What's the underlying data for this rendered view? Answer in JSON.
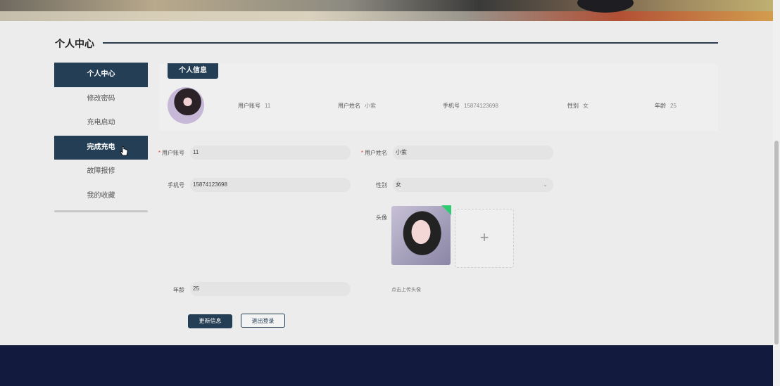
{
  "page_title": "个人中心",
  "sidebar": {
    "items": [
      {
        "label": "个人中心",
        "active": true
      },
      {
        "label": "修改密码",
        "active": false
      },
      {
        "label": "充电启动",
        "active": false
      },
      {
        "label": "完成充电",
        "active": true
      },
      {
        "label": "故障报修",
        "active": false
      },
      {
        "label": "我的收藏",
        "active": false
      }
    ]
  },
  "info_card": {
    "tab_label": "个人信息",
    "fields": {
      "account_label": "用户账号",
      "account_value": "11",
      "name_label": "用户姓名",
      "name_value": "小紫",
      "phone_label": "手机号",
      "phone_value": "15874123698",
      "gender_label": "性别",
      "gender_value": "女",
      "age_label": "年龄",
      "age_value": "25"
    }
  },
  "form": {
    "account_label": "用户账号",
    "account_value": "11",
    "name_label": "用户姓名",
    "name_value": "小紫",
    "phone_label": "手机号",
    "phone_value": "15874123698",
    "gender_label": "性别",
    "gender_value": "女",
    "avatar_label": "头像",
    "upload_tip": "点击上传头像",
    "age_label": "年龄",
    "age_value": "25",
    "plus_glyph": "+"
  },
  "buttons": {
    "update": "更新信息",
    "logout": "退出登录"
  },
  "colors": {
    "primary": "#243e55",
    "footer": "#121a3d",
    "required": "#e04b4b"
  }
}
